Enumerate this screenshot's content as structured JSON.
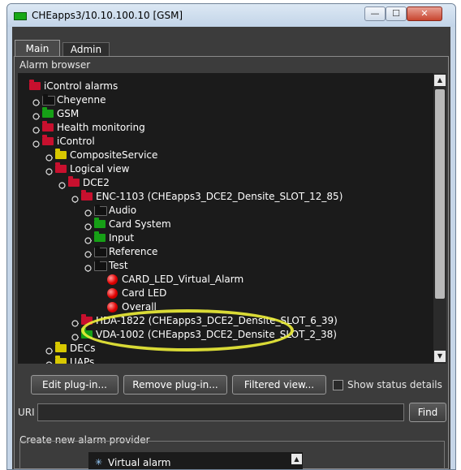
{
  "window": {
    "title": "CHEapps3/10.10.100.10 [GSM]",
    "controls": {
      "minimize": "—",
      "maximize": "☐",
      "close": "✕"
    }
  },
  "tabs": [
    {
      "label": "Main",
      "active": true
    },
    {
      "label": "Admin",
      "active": false
    }
  ],
  "alarm_browser": {
    "label": "Alarm browser",
    "tree": [
      {
        "label": "iControl alarms",
        "icon": "folder-red-open",
        "expander": "none"
      },
      {
        "label": "Cheyenne",
        "icon": "folder-black",
        "expander": "collapsed"
      },
      {
        "label": "GSM",
        "icon": "folder-green",
        "expander": "collapsed"
      },
      {
        "label": "Health monitoring",
        "icon": "folder-red",
        "expander": "collapsed"
      },
      {
        "label": "iControl",
        "icon": "folder-red-open",
        "expander": "expanded"
      },
      {
        "label": "CompositeService",
        "icon": "folder-yellow",
        "expander": "collapsed"
      },
      {
        "label": "Logical view",
        "icon": "folder-red-open",
        "expander": "expanded"
      },
      {
        "label": "DCE2",
        "icon": "folder-red-open",
        "expander": "expanded"
      },
      {
        "label": "ENC-1103 (CHEapps3_DCE2_Densite_SLOT_12_85)",
        "icon": "folder-red-open",
        "expander": "expanded"
      },
      {
        "label": "Audio",
        "icon": "folder-black",
        "expander": "collapsed"
      },
      {
        "label": "Card System",
        "icon": "folder-green",
        "expander": "collapsed"
      },
      {
        "label": "Input",
        "icon": "folder-green",
        "expander": "collapsed"
      },
      {
        "label": "Reference",
        "icon": "folder-black",
        "expander": "collapsed"
      },
      {
        "label": "Test",
        "icon": "folder-black-open",
        "expander": "expanded"
      },
      {
        "label": "CARD_LED_Virtual_Alarm",
        "icon": "red-led",
        "expander": "none"
      },
      {
        "label": "Card LED",
        "icon": "red-led",
        "expander": "none"
      },
      {
        "label": "Overall",
        "icon": "red-led",
        "expander": "none"
      },
      {
        "label": "HDA-1822 (CHEapps3_DCE2_Densite_SLOT_6_39)",
        "icon": "folder-red",
        "expander": "collapsed"
      },
      {
        "label": "VDA-1002 (CHEapps3_DCE2_Densite_SLOT_2_38)",
        "icon": "folder-green",
        "expander": "collapsed"
      },
      {
        "label": "DECs",
        "icon": "folder-yellow",
        "expander": "collapsed"
      },
      {
        "label": "UAPs",
        "icon": "folder-yellow",
        "expander": "collapsed"
      }
    ],
    "highlighted_item": "CARD_LED_Virtual_Alarm"
  },
  "toolbar": {
    "edit_plugin": "Edit plug-in...",
    "remove_plugin": "Remove plug-in...",
    "filtered_view": "Filtered view...",
    "show_status_details": "Show status details",
    "show_status_checked": false
  },
  "uri": {
    "label": "URI",
    "value": "",
    "find": "Find"
  },
  "provider": {
    "label": "Create new alarm provider",
    "items": [
      {
        "label": "Virtual alarm",
        "icon": "virtual-alarm-icon"
      }
    ]
  },
  "colors": {
    "panel_bg": "#3c3c3c",
    "tree_bg": "#1b1b1b",
    "highlight_ellipse": "#eef03a",
    "led_red": "#e00000"
  }
}
